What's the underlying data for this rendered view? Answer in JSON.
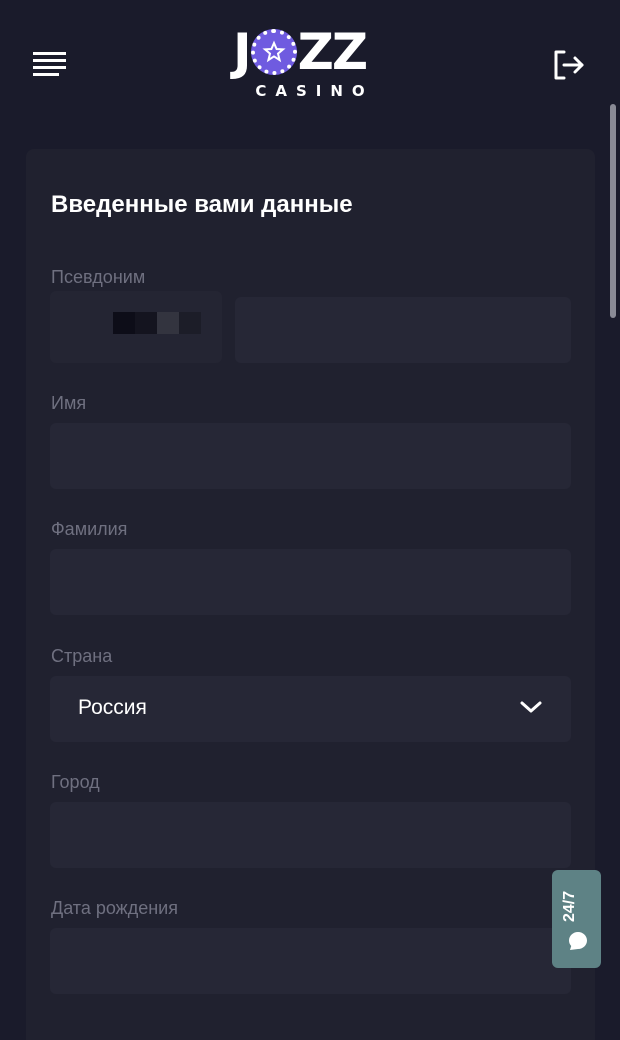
{
  "header": {
    "logo_main": "JOZZ",
    "logo_sub": "CASINO",
    "menu_icon": "hamburger-menu-icon",
    "logout_icon": "logout-icon"
  },
  "form": {
    "title": "Введенные вами данные",
    "fields": {
      "nickname": {
        "label": "Псевдоним"
      },
      "first_name": {
        "label": "Имя"
      },
      "last_name": {
        "label": "Фамилия"
      },
      "country": {
        "label": "Страна",
        "value": "Россия"
      },
      "city": {
        "label": "Город"
      },
      "birth_date": {
        "label": "Дата рождения"
      }
    }
  },
  "support": {
    "label": "24/7",
    "icon": "chat-bubble-icon"
  },
  "colors": {
    "background": "#1a1b2b",
    "card": "#20212f",
    "field": "#262736",
    "label": "#6f7080",
    "accent": "#6f5be0",
    "support": "#5e8285"
  }
}
